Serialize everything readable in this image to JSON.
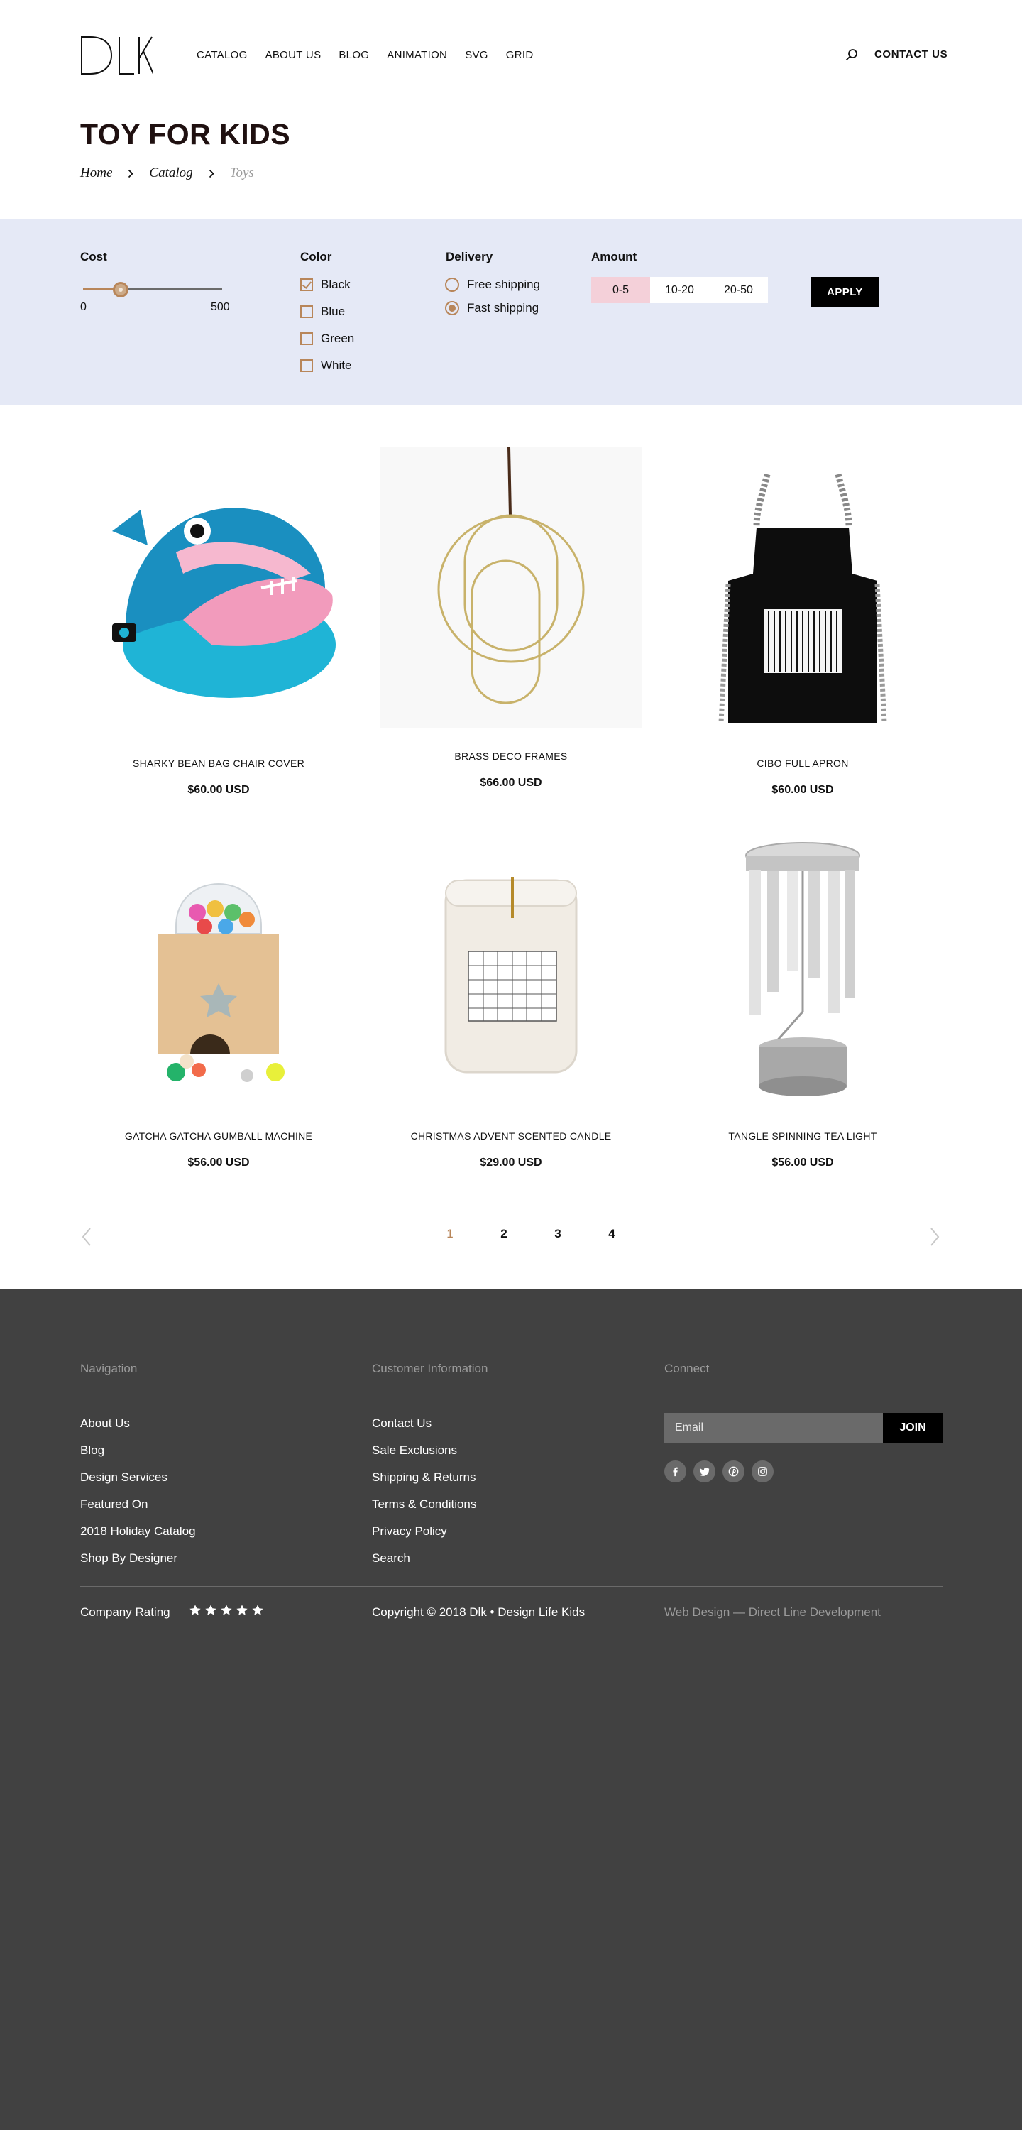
{
  "header": {
    "logo_text": "DLK",
    "nav": [
      "CATALOG",
      "ABOUT US",
      "BLOG",
      "ANIMATION",
      "SVG",
      "GRID"
    ],
    "search_icon": "search-icon",
    "contact_label": "CONTACT US"
  },
  "page": {
    "title": "TOY FOR KIDS",
    "breadcrumb": [
      "Home",
      "Catalog",
      "Toys"
    ]
  },
  "filters": {
    "cost": {
      "title": "Cost",
      "min": "0",
      "max": "500",
      "value_fraction": 0.27
    },
    "color": {
      "title": "Color",
      "options": [
        {
          "label": "Black",
          "checked": true
        },
        {
          "label": "Blue",
          "checked": false
        },
        {
          "label": "Green",
          "checked": false
        },
        {
          "label": "White",
          "checked": false
        }
      ]
    },
    "delivery": {
      "title": "Delivery",
      "options": [
        {
          "label": "Free shipping",
          "selected": false
        },
        {
          "label": "Fast shipping",
          "selected": true
        }
      ]
    },
    "amount": {
      "title": "Amount",
      "options": [
        "0-5",
        "10-20",
        "20-50"
      ],
      "selected": "0-5"
    },
    "apply_label": "APPLY"
  },
  "products": [
    {
      "name": "SHARKY BEAN BAG CHAIR COVER",
      "price": "$60.00 USD"
    },
    {
      "name": "BRASS DECO FRAMES",
      "price": "$66.00 USD"
    },
    {
      "name": "CIBO FULL APRON",
      "price": "$60.00 USD"
    },
    {
      "name": "GATCHA GATCHA GUMBALL MACHINE",
      "price": "$56.00 USD"
    },
    {
      "name": "CHRISTMAS ADVENT SCENTED CANDLE",
      "price": "$29.00 USD"
    },
    {
      "name": "TANGLE SPINNING TEA LIGHT",
      "price": "$56.00 USD"
    }
  ],
  "pagination": {
    "pages": [
      "1",
      "2",
      "3",
      "4"
    ],
    "current": "1"
  },
  "footer": {
    "navigation": {
      "title": "Navigation",
      "links": [
        "About Us",
        "Blog",
        "Design Services",
        "Featured On",
        "2018 Holiday Catalog",
        "Shop By Designer"
      ]
    },
    "customer": {
      "title": "Customer Information",
      "links": [
        "Contact Us",
        "Sale Exclusions",
        "Shipping & Returns",
        "Terms & Conditions",
        "Privacy Policy",
        "Search"
      ]
    },
    "connect": {
      "title": "Connect",
      "email_placeholder": "Email",
      "join_label": "JOIN",
      "social": [
        "facebook-icon",
        "twitter-icon",
        "pinterest-icon",
        "instagram-icon"
      ]
    },
    "rating_label": "Company Rating",
    "rating_stars": 5,
    "copyright": "Copyright © 2018 Dlk • Design Life Kids",
    "credit": "Web Design — Direct Line Development"
  },
  "colors": {
    "accent": "#b8865a",
    "filter_bg": "#e5e9f6",
    "selected_amount": "#f4d0d9",
    "footer_bg": "#414141"
  }
}
